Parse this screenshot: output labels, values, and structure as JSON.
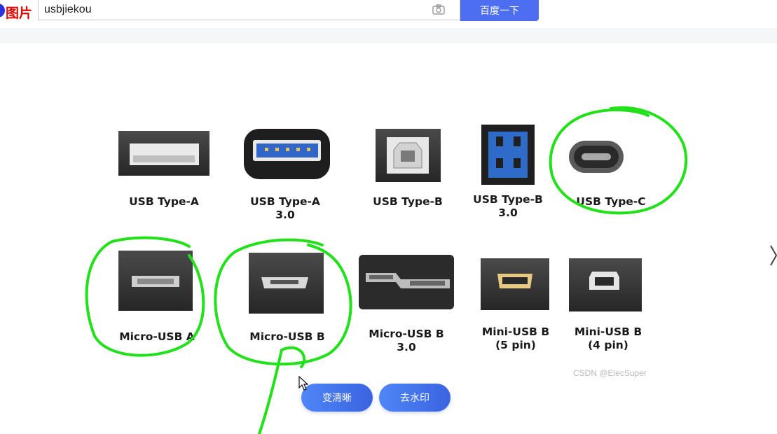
{
  "header": {
    "logo_text": "图片",
    "search_value": "usbjiekou",
    "camera_icon": "camera-icon",
    "search_button_label": "百度一下",
    "brand_color": "#4e6ef2"
  },
  "image": {
    "connectors": [
      {
        "label": "USB Type-A"
      },
      {
        "label": "USB Type-A\n3.0"
      },
      {
        "label": "USB Type-B"
      },
      {
        "label": "USB Type-B\n3.0"
      },
      {
        "label": "USB Type-C"
      },
      {
        "label": "Micro-USB A"
      },
      {
        "label": "Micro-USB B"
      },
      {
        "label": "Micro-USB B\n3.0"
      },
      {
        "label": "Mini-USB B\n(5 pin)"
      },
      {
        "label": "Mini-USB B\n(4 pin)"
      }
    ],
    "watermark": "CSDN @ElecSuper",
    "annotation_color": "#22e01a"
  },
  "actions": {
    "enhance_label": "变清晰",
    "remove_watermark_label": "去水印"
  },
  "viewer": {
    "next_icon": "chevron-right-icon"
  }
}
